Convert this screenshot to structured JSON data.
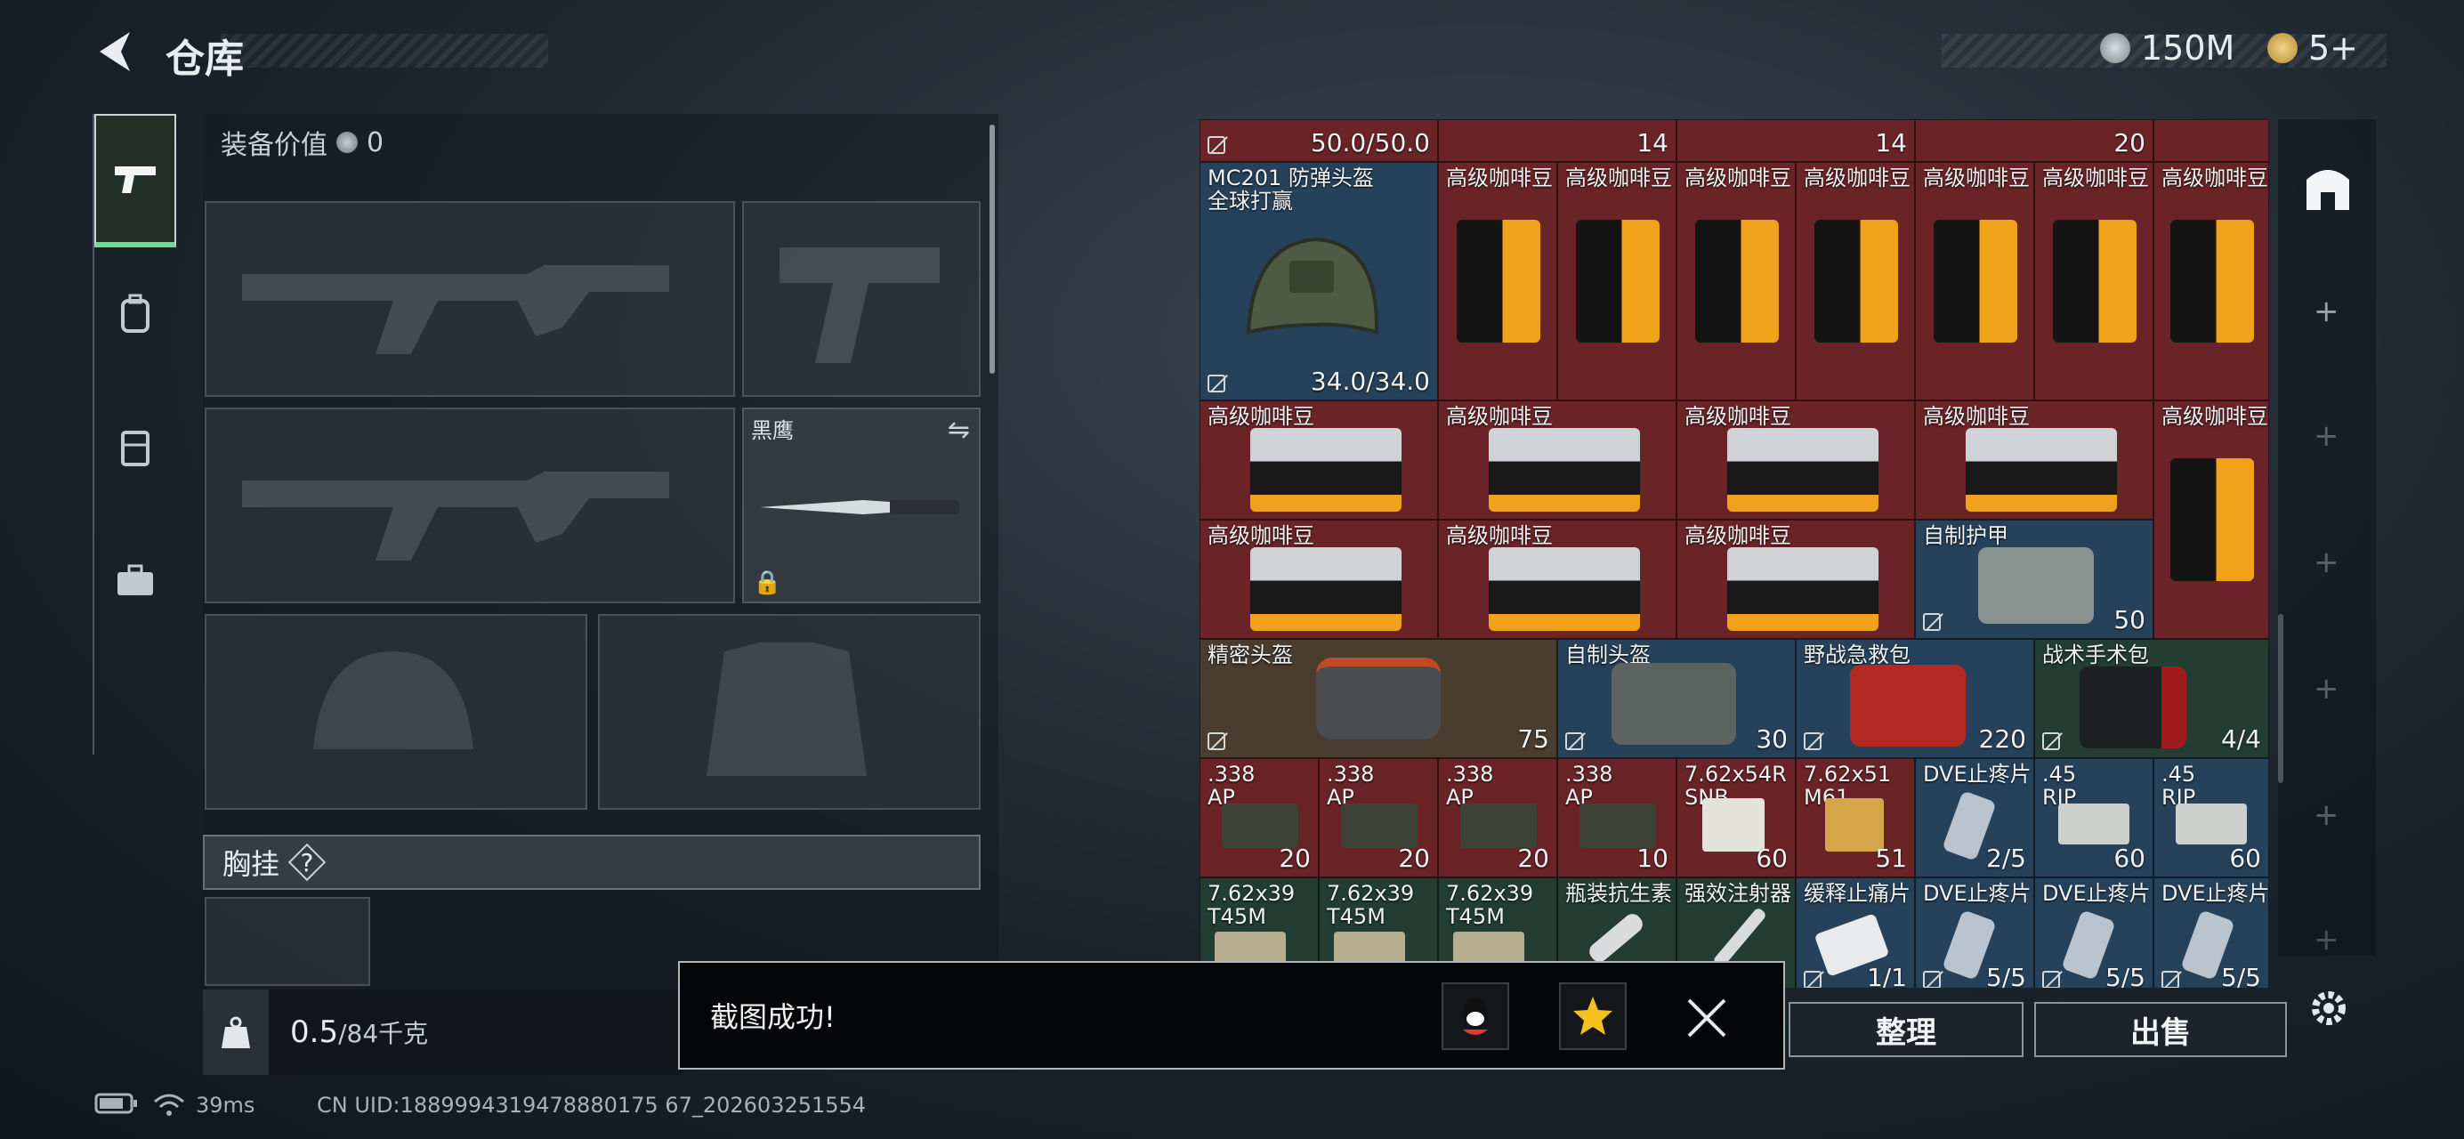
{
  "header": {
    "title": "仓库",
    "currency_silver": "150M",
    "currency_gold": "5+"
  },
  "equipment": {
    "value_label": "装备价值",
    "value": "0",
    "knife_name": "黑鹰",
    "chest_label": "胸挂",
    "chest_help": "?",
    "weight_current": "0.5",
    "weight_max": "/84千克"
  },
  "inventory": {
    "top_row": [
      "50.0/50.0",
      "14",
      "14",
      "20"
    ],
    "helmet_name": "MC201 防弹头盔\n全球打赢",
    "helmet_durability": "34.0/34.0",
    "coffee_label": "高级咖啡豆",
    "armor_name": "自制护甲",
    "armor_val": "50",
    "precision_helmet": "精密头盔",
    "precision_val": "75",
    "homemade_helmet": "自制头盔",
    "homemade_val": "30",
    "firstaid": "野战急救包",
    "firstaid_val": "220",
    "surgical": "战术手术包",
    "surgical_val": "4/4",
    "ammo_row": [
      {
        "name": ".338\nAP",
        "count": "20"
      },
      {
        "name": ".338\nAP",
        "count": "20"
      },
      {
        "name": ".338\nAP",
        "count": "20"
      },
      {
        "name": ".338\nAP",
        "count": "10"
      },
      {
        "name": "7.62x54R\nSNB",
        "count": "60"
      },
      {
        "name": "7.62x51\nM61",
        "count": "51"
      },
      {
        "name": "DVE止疼片",
        "count": "2/5"
      },
      {
        "name": ".45\nRIP",
        "count": "60"
      },
      {
        "name": ".45\nRIP",
        "count": "60"
      }
    ],
    "bottom_row": [
      {
        "name": "7.62x39\nT45M",
        "count": ""
      },
      {
        "name": "7.62x39\nT45M",
        "count": ""
      },
      {
        "name": "7.62x39\nT45M",
        "count": ""
      },
      {
        "name": "瓶装抗生素",
        "count": ""
      },
      {
        "name": "强效注射器",
        "count": ""
      },
      {
        "name": "缓释止痛片",
        "count": "1/1"
      },
      {
        "name": "DVE止疼片",
        "count": "5/5"
      },
      {
        "name": "DVE止疼片",
        "count": "5/5"
      },
      {
        "name": "DVE止疼片",
        "count": "5/5"
      }
    ]
  },
  "actions": {
    "organize": "整理",
    "sell": "出售"
  },
  "toast": {
    "message": "截图成功!"
  },
  "status": {
    "ping": "39ms",
    "uid": "CN UID:1889994319478880175 67_202603251554"
  }
}
